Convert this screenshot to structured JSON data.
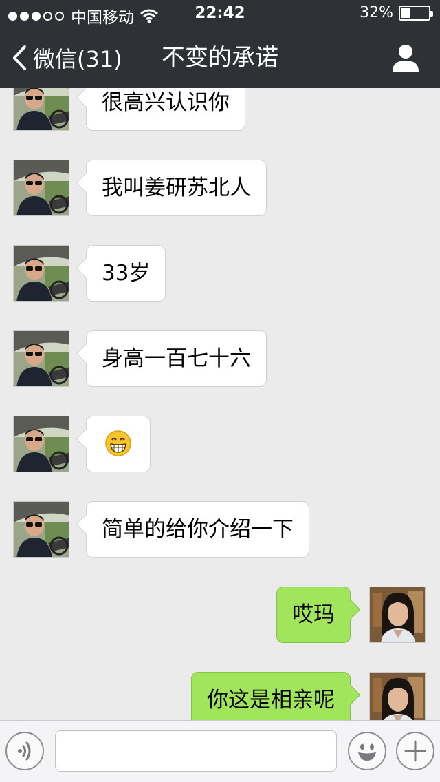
{
  "status_bar": {
    "signal_dots": [
      true,
      true,
      true,
      false,
      false
    ],
    "carrier": "中国移动",
    "time": "22:42",
    "battery_percent": "32%",
    "battery_level": 0.32
  },
  "nav": {
    "back_label": "微信(31)",
    "title": "不变的承诺",
    "profile_icon": "person-icon"
  },
  "messages": [
    {
      "side": "in",
      "text": "很高兴认识你",
      "avatar": "man-driving-avatar"
    },
    {
      "side": "in",
      "text": "我叫姜研苏北人",
      "avatar": "man-driving-avatar"
    },
    {
      "side": "in",
      "text": "33岁",
      "avatar": "man-driving-avatar"
    },
    {
      "side": "in",
      "text": "身高一百七十六",
      "avatar": "man-driving-avatar"
    },
    {
      "side": "in",
      "text": "",
      "emoji": "grin-emoji",
      "avatar": "man-driving-avatar"
    },
    {
      "side": "in",
      "text": "简单的给你介绍一下",
      "avatar": "man-driving-avatar"
    },
    {
      "side": "out",
      "text": "哎玛",
      "avatar": "woman-avatar"
    },
    {
      "side": "out",
      "text": "你这是相亲呢",
      "avatar": "woman-avatar"
    }
  ],
  "input_bar": {
    "voice_icon": "voice-icon",
    "text_value": "",
    "emoji_icon": "smiley-icon",
    "more_icon": "plus-icon"
  },
  "colors": {
    "header_bg": "#2e3236",
    "chat_bg": "#ebebeb",
    "incoming_bubble": "#ffffff",
    "outgoing_bubble": "#a0e55c"
  }
}
